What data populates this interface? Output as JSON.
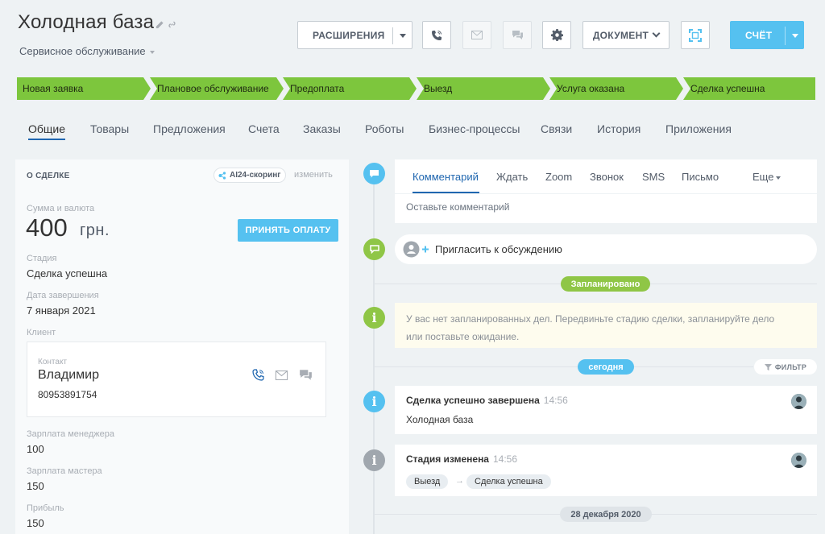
{
  "header": {
    "title": "Холодная база",
    "category": "Сервисное обслуживание",
    "buttons": {
      "extensions": "РАСШИРЕНИЯ",
      "document": "ДОКУМЕНТ",
      "invoice": "СЧЁТ"
    }
  },
  "stages": [
    {
      "label": "Новая заявка"
    },
    {
      "label": "Плановое обслуживание"
    },
    {
      "label": "Предоплата"
    },
    {
      "label": "Выезд"
    },
    {
      "label": "Услуга оказана"
    },
    {
      "label": "Сделка успешна"
    }
  ],
  "tabs": [
    {
      "label": "Общие"
    },
    {
      "label": "Товары"
    },
    {
      "label": "Предложения"
    },
    {
      "label": "Счета"
    },
    {
      "label": "Заказы"
    },
    {
      "label": "Роботы"
    },
    {
      "label": "Бизнес-процессы"
    },
    {
      "label": "Связи"
    },
    {
      "label": "История"
    },
    {
      "label": "Приложения"
    }
  ],
  "deal": {
    "section_title": "О СДЕЛКЕ",
    "ai_badge": "AI24-скоринг",
    "change_link": "изменить",
    "amount_label": "Сумма и валюта",
    "amount": "400",
    "currency": "грн.",
    "pay_button": "ПРИНЯТЬ ОПЛАТУ",
    "stage_label": "Стадия",
    "stage_value": "Сделка успешна",
    "close_date_label": "Дата завершения",
    "close_date_value": "7 января 2021",
    "client_label": "Клиент",
    "contact": {
      "label": "Контакт",
      "name": "Владимир",
      "phone": "80953891754"
    },
    "manager_salary_label": "Зарплата менеджера",
    "manager_salary_value": "100",
    "master_salary_label": "Зарплата мастера",
    "master_salary_value": "150",
    "profit_label": "Прибыль",
    "profit_value": "150"
  },
  "composer": {
    "tabs": [
      "Комментарий",
      "Ждать",
      "Zoom",
      "Звонок",
      "SMS",
      "Письмо"
    ],
    "more": "Еще",
    "placeholder": "Оставьте комментарий"
  },
  "timeline": {
    "invite": "Пригласить к обсуждению",
    "planned_label": "Запланировано",
    "notice": "У вас нет запланированных дел. Передвиньте стадию сделки, запланируйте дело или поставьте ожидание.",
    "today_label": "сегодня",
    "filter_label": "ФИЛЬТР",
    "events": [
      {
        "title": "Сделка успешно завершена",
        "time": "14:56",
        "body": "Холодная база"
      },
      {
        "title": "Стадия изменена",
        "time": "14:56",
        "from": "Выезд",
        "to": "Сделка успешна"
      }
    ],
    "date_label": "28 декабря 2020"
  },
  "colors": {
    "accent": "#55c1f0",
    "stage_green": "#7dc63d",
    "link_blue": "#2067b0"
  },
  "icons": [
    "edit-icon",
    "link-icon",
    "phone-icon",
    "mail-icon",
    "chat-icon",
    "gear-icon",
    "expand-icon",
    "comment-icon",
    "info-icon",
    "invite-user-icon",
    "filter-icon"
  ]
}
